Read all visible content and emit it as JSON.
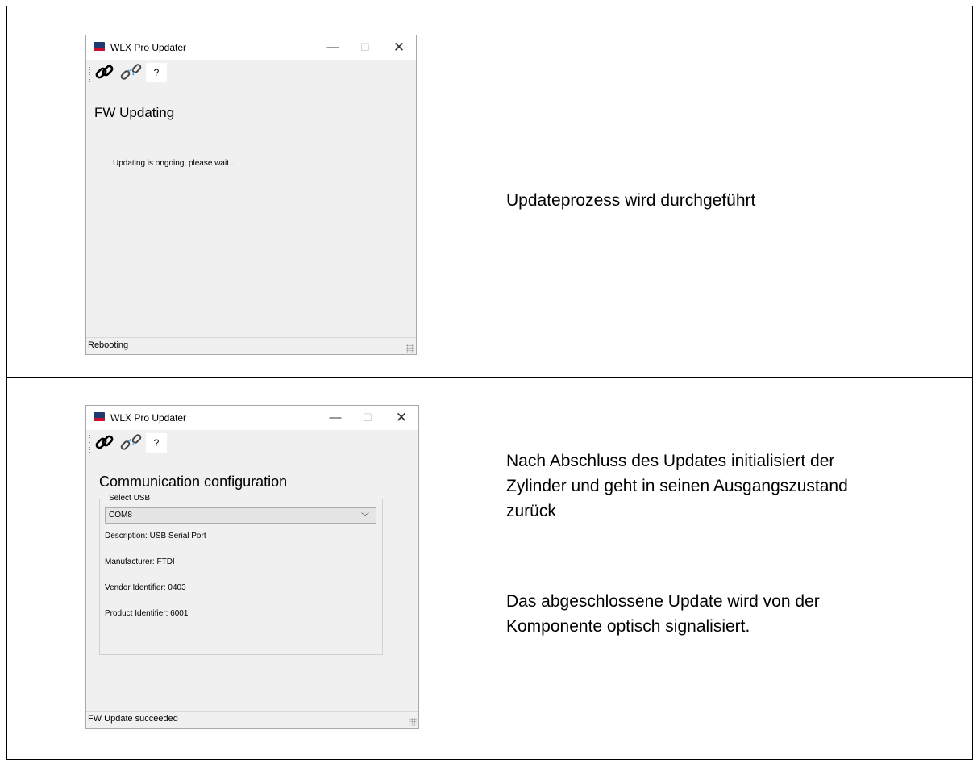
{
  "rows": [
    {
      "window": {
        "title": "WLX Pro Updater",
        "buttons": {
          "minimize": "—",
          "maximize": "☐",
          "close": "✕"
        },
        "toolbar": {
          "help_label": "?"
        },
        "heading": "FW Updating",
        "message": "Updating is ongoing, please wait...",
        "status": "Rebooting"
      },
      "caption": "Updateprozess wird durchgeführt"
    },
    {
      "window": {
        "title": "WLX Pro Updater",
        "buttons": {
          "minimize": "—",
          "maximize": "☐",
          "close": "✕"
        },
        "toolbar": {
          "help_label": "?"
        },
        "heading": "Communication configuration",
        "group_label": "Select USB",
        "selected_port": "COM8",
        "details": [
          "Description: USB Serial Port",
          "Manufacturer: FTDI",
          "Vendor Identifier: 0403",
          "Product Identifier: 6001"
        ],
        "status": "FW Update succeeded"
      },
      "caption_lines": [
        "Nach Abschluss des Updates initialisiert der",
        "Zylinder und geht in seinen Ausgangszustand",
        "zurück"
      ],
      "caption2_lines": [
        "Das abgeschlossene Update wird von der",
        "Komponente optisch signalisiert."
      ]
    }
  ],
  "icons": {
    "app": "app-logo-icon",
    "connect": "link-icon",
    "disconnect": "broken-link-icon",
    "dropdown": "chevron-down-icon",
    "resize": "size-grip-icon"
  },
  "colors": {
    "window_bg": "#f0f0f0",
    "link_blue": "#3b8fd6",
    "text": "#000000"
  }
}
